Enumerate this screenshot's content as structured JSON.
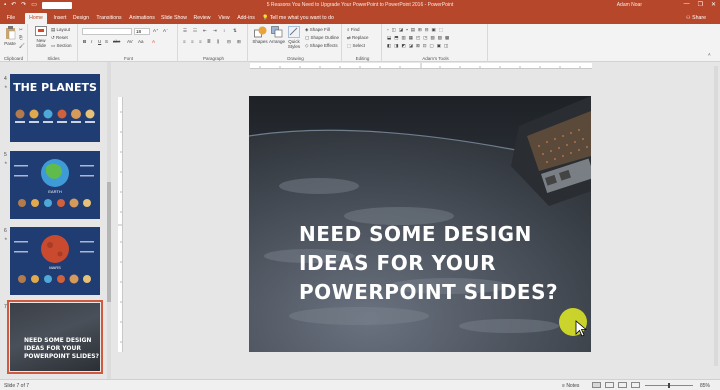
{
  "titlebar": {
    "title": "5 Reasons You Need to Upgrade Your PowerPoint to PowerPoint 2016 - PowerPoint",
    "user": "Adam Noar",
    "minimize": "—",
    "restore": "❐",
    "close": "✕"
  },
  "tabs": [
    "File",
    "Home",
    "Insert",
    "Design",
    "Transitions",
    "Animations",
    "Slide Show",
    "Review",
    "View",
    "Add-ins"
  ],
  "tell_me": "Tell me what you want to do",
  "share": "Share",
  "ribbon": {
    "clipboard": {
      "label": "Clipboard",
      "paste": "Paste"
    },
    "slides": {
      "label": "Slides",
      "new_slide": "New Slide",
      "layout": "Layout",
      "reset": "Reset",
      "section": "Section"
    },
    "font": {
      "label": "Font",
      "size": "18"
    },
    "paragraph": {
      "label": "Paragraph"
    },
    "drawing": {
      "label": "Drawing",
      "shapes": "Shapes",
      "arrange": "Arrange",
      "quick_styles": "Quick Styles",
      "shape_fill": "Shape Fill",
      "shape_outline": "Shape Outline",
      "shape_effects": "Shape Effects"
    },
    "editing": {
      "label": "Editing",
      "find": "Find",
      "replace": "Replace",
      "select": "Select"
    },
    "adams_tools": {
      "label": "Adam's Tools"
    }
  },
  "thumbnails": [
    {
      "num": "4",
      "title": "THE PLANETS"
    },
    {
      "num": "5",
      "title": "EARTH"
    },
    {
      "num": "6",
      "title": "MARS"
    },
    {
      "num": "7",
      "title": "NEED SOME DESIGN IDEAS FOR YOUR POWERPOINT SLIDES?"
    }
  ],
  "slide": {
    "line1": "NEED SOME DESIGN",
    "line2": "IDEAS FOR YOUR",
    "line3": "POWERPOINT SLIDES?"
  },
  "thumb7_lines": [
    "NEED SOME DESIGN",
    "IDEAS FOR YOUR",
    "POWERPOINT SLIDES?"
  ],
  "status": {
    "slide_info": "Slide 7 of 7",
    "notes": "Notes",
    "zoom": "85%"
  },
  "colors": {
    "accent": "#b7472a",
    "slide_bg": "#3a3f46",
    "cursor_highlight": "#d6e028"
  }
}
